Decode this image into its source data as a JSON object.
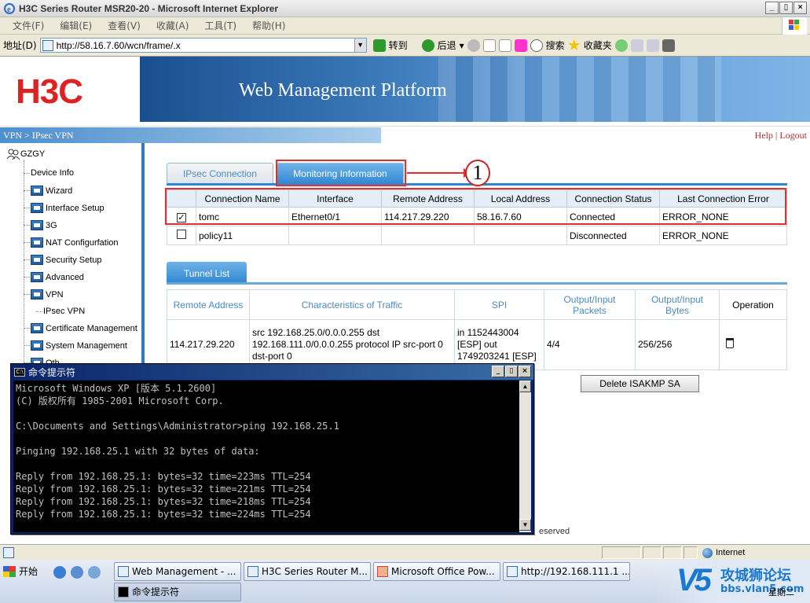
{
  "ie": {
    "title": "H3C Series Router MSR20-20 - Microsoft Internet Explorer",
    "menu": [
      "文件(F)",
      "编辑(E)",
      "查看(V)",
      "收藏(A)",
      "工具(T)",
      "帮助(H)"
    ],
    "address_label": "地址(D)",
    "url": "http://58.16.7.60/wcn/frame/.x",
    "go_label": "转到",
    "back_label": "后退",
    "search_label": "搜索",
    "favorites_label": "收藏夹",
    "window_buttons": [
      "_",
      "▯",
      "×"
    ]
  },
  "page": {
    "logo_text": "H3C",
    "banner_title": "Web Management Platform",
    "breadcrumb": "VPN > IPsec VPN",
    "help_links": "Help | Logout",
    "sidebar": {
      "root": "GZGY",
      "items": [
        {
          "label": "Device Info",
          "icon": false
        },
        {
          "label": "Wizard",
          "icon": true
        },
        {
          "label": "Interface Setup",
          "icon": true
        },
        {
          "label": "3G",
          "icon": true
        },
        {
          "label": "NAT Configurfation",
          "icon": true
        },
        {
          "label": "Security Setup",
          "icon": true
        },
        {
          "label": "Advanced",
          "icon": true
        },
        {
          "label": "VPN",
          "icon": true
        },
        {
          "label": "IPsec VPN",
          "icon": false
        },
        {
          "label": "Certificate Management",
          "icon": true
        },
        {
          "label": "System Management",
          "icon": true
        },
        {
          "label": "Oth",
          "icon": true
        }
      ]
    },
    "tabs": {
      "ipsec_connection": "IPsec Connection",
      "monitoring_information": "Monitoring Information"
    },
    "callout_number": "1",
    "connection_table": {
      "headers": [
        "",
        "Connection Name",
        "Interface",
        "Remote Address",
        "Local Address",
        "Connection Status",
        "Last Connection Error"
      ],
      "rows": [
        {
          "checked": true,
          "name": "tomc",
          "interface": "Ethernet0/1",
          "remote": "114.217.29.220",
          "local": "58.16.7.60",
          "status": "Connected",
          "error": "ERROR_NONE"
        },
        {
          "checked": false,
          "name": "policy11",
          "interface": "",
          "remote": "",
          "local": "",
          "status": "Disconnected",
          "error": "ERROR_NONE"
        }
      ]
    },
    "tunnel_list_tab": "Tunnel List",
    "tunnel_table": {
      "headers": [
        "Remote Address",
        "Characteristics of Traffic",
        "SPI",
        "Output/Input Packets",
        "Output/Input Bytes",
        "Operation"
      ],
      "row": {
        "remote": "114.217.29.220",
        "traffic": "src 192.168.25.0/0.0.0.255 dst 192.168.111.0/0.0.0.255 protocol IP src-port 0 dst-port 0",
        "spi": "in 1152443004 [ESP] out 1749203241 [ESP]",
        "packets": "4/4",
        "bytes": "256/256"
      }
    },
    "delete_isakmp_label": "Delete ISAKMP SA",
    "footer_fragment": "eserved"
  },
  "cmd": {
    "title": "命令提示符",
    "lines": [
      "Microsoft Windows XP [版本 5.1.2600]",
      "(C) 版权所有 1985-2001 Microsoft Corp.",
      "",
      "C:\\Documents and Settings\\Administrator>ping 192.168.25.1",
      "",
      "Pinging 192.168.25.1 with 32 bytes of data:",
      "",
      "Reply from 192.168.25.1: bytes=32 time=223ms TTL=254",
      "Reply from 192.168.25.1: bytes=32 time=221ms TTL=254",
      "Reply from 192.168.25.1: bytes=32 time=218ms TTL=254",
      "Reply from 192.168.25.1: bytes=32 time=224ms TTL=254"
    ]
  },
  "statusbar": {
    "zone": "Internet"
  },
  "taskbar": {
    "start": "开始",
    "buttons": [
      "Web Management - ...",
      "H3C Series Router M...",
      "Microsoft Office Pow...",
      "http://192.168.111.1 ...",
      "命令提示符"
    ],
    "watermark_title": "攻城狮论坛",
    "watermark_url": "bbs.vlan5.com",
    "day": "星期二"
  },
  "colors": {
    "accent_blue": "#2f86d2",
    "callout_red": "#e23030",
    "logo_red": "#dd2222"
  }
}
